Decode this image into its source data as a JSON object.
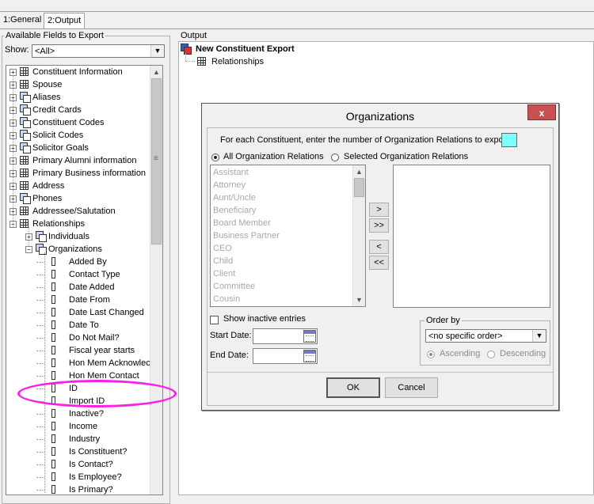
{
  "tabs": [
    {
      "label": "1:General",
      "active": false
    },
    {
      "label": "2:Output",
      "active": true
    }
  ],
  "left_panel": {
    "title": "Available Fields to Export",
    "show_label": "Show:",
    "show_value": "<All>"
  },
  "tree": {
    "top_level": [
      {
        "label": "Constituent Information",
        "icon": "table-icon"
      },
      {
        "label": "Spouse",
        "icon": "table-icon"
      },
      {
        "label": "Aliases",
        "icon": "multi-table-icon"
      },
      {
        "label": "Credit Cards",
        "icon": "multi-table-icon"
      },
      {
        "label": "Constituent Codes",
        "icon": "multi-table-icon"
      },
      {
        "label": "Solicit Codes",
        "icon": "multi-table-icon"
      },
      {
        "label": "Solicitor Goals",
        "icon": "multi-table-icon"
      },
      {
        "label": "Primary Alumni information",
        "icon": "table-icon"
      },
      {
        "label": "Primary Business information",
        "icon": "table-icon"
      },
      {
        "label": "Address",
        "icon": "table-icon"
      },
      {
        "label": "Phones",
        "icon": "multi-table-icon"
      },
      {
        "label": "Addressee/Salutation",
        "icon": "table-icon"
      },
      {
        "label": "Relationships",
        "icon": "table-icon"
      }
    ],
    "relationship_children": [
      {
        "label": "Individuals"
      },
      {
        "label": "Organizations"
      }
    ],
    "organization_fields": [
      "Added By",
      "Contact Type",
      "Date Added",
      "Date From",
      "Date Last Changed",
      "Date To",
      "Do Not Mail?",
      "Fiscal year starts",
      "Hon Mem Acknowlec",
      "Hon Mem Contact",
      "ID",
      "Import ID",
      "Inactive?",
      "Income",
      "Industry",
      "Is Constituent?",
      "Is Contact?",
      "Is Employee?",
      "Is Primary?"
    ]
  },
  "output_panel": {
    "title": "Output",
    "root": "New Constituent Export",
    "child": "Relationships"
  },
  "dialog": {
    "title": "Organizations",
    "close_label": "x",
    "count_prompt": "For each Constituent, enter the number of Organization Relations to export:",
    "count_value": "",
    "radio_all": "All Organization Relations",
    "radio_selected": "Selected Organization Relations",
    "available_relations": [
      "Assistant",
      "Attorney",
      "Aunt/Uncle",
      "Beneficiary",
      "Board Member",
      "Business Partner",
      "CEO",
      "Child",
      "Client",
      "Committee",
      "Cousin"
    ],
    "move_buttons": [
      ">",
      ">>",
      "<",
      "<<"
    ],
    "show_inactive_label": "Show inactive entries",
    "start_date_label": "Start Date:",
    "end_date_label": "End Date:",
    "order_by": {
      "title": "Order by",
      "value": "<no specific order>",
      "ascending": "Ascending",
      "descending": "Descending"
    },
    "ok_label": "OK",
    "cancel_label": "Cancel"
  },
  "colors": {
    "highlight_oval": "#ff1ee6",
    "count_field": "#80ffff",
    "close_button": "#c75050"
  }
}
